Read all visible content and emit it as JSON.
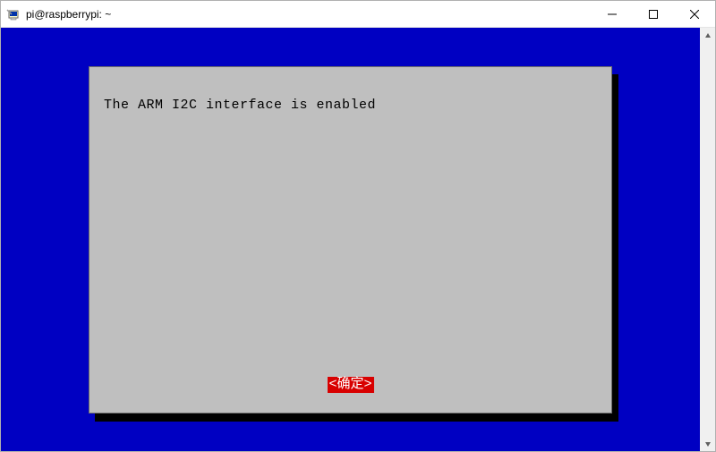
{
  "window": {
    "title": "pi@raspberrypi: ~"
  },
  "dialog": {
    "message": "The ARM I2C interface is enabled",
    "ok_label": "<确定>"
  },
  "colors": {
    "terminal_bg": "#0000c2",
    "dialog_bg": "#bfbfbf",
    "button_bg": "#d80000",
    "button_fg": "#ffffff"
  }
}
